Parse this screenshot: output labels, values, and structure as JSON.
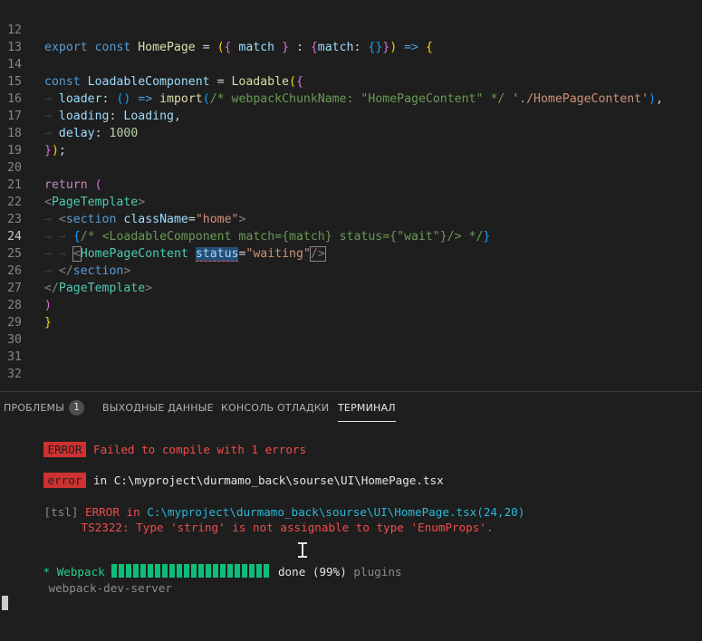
{
  "editor": {
    "lines": [
      {
        "n": "12",
        "t": [
          "export",
          " const ",
          "HomePage",
          " = ",
          "(",
          "{",
          " match ",
          "}",
          " : ",
          "{",
          "match",
          ": ",
          "{",
          "}",
          "}",
          ")",
          " => ",
          "{"
        ]
      },
      {
        "n": "13",
        "t": []
      },
      {
        "n": "14",
        "t": [
          "const ",
          "LoadableComponent",
          " = ",
          "Loadable",
          "(",
          "{"
        ]
      },
      {
        "n": "15",
        "t": [
          "loader",
          ": ",
          "(",
          ")",
          " => ",
          "import",
          "(",
          "/* webpackChunkName: \"HomePageContent\" */",
          " ",
          "'./HomePageContent'",
          ")",
          ","
        ]
      },
      {
        "n": "16",
        "t": [
          "loading",
          ": ",
          "Loading",
          ","
        ]
      },
      {
        "n": "17",
        "t": [
          "delay",
          ": ",
          "1000"
        ]
      },
      {
        "n": "18",
        "t": [
          "}",
          ")",
          ";"
        ]
      },
      {
        "n": "19",
        "t": []
      },
      {
        "n": "20",
        "t": [
          "return",
          " ",
          "("
        ]
      },
      {
        "n": "21",
        "t": [
          "<",
          "PageTemplate",
          ">"
        ]
      },
      {
        "n": "22",
        "t": [
          "<",
          "section",
          " ",
          "className",
          "=",
          "\"home\"",
          ">"
        ]
      },
      {
        "n": "23",
        "t": [
          "{",
          "/* <LoadableComponent match={match} status={\"wait\"}/> */",
          "}"
        ]
      },
      {
        "n": "24",
        "t": [
          "<",
          "HomePageContent",
          " ",
          "status",
          "=",
          "\"waiting\"",
          "/>"
        ]
      },
      {
        "n": "25",
        "t": [
          "</",
          "section",
          ">"
        ]
      },
      {
        "n": "26",
        "t": [
          "</",
          "PageTemplate",
          ">"
        ]
      },
      {
        "n": "27",
        "t": [
          ")"
        ]
      },
      {
        "n": "28",
        "t": [
          "}"
        ]
      },
      {
        "n": "29",
        "t": []
      },
      {
        "n": "30",
        "t": []
      },
      {
        "n": "31",
        "t": []
      },
      {
        "n": "32",
        "t": []
      }
    ],
    "active_line": "24",
    "guide_arrow": "→"
  },
  "panel": {
    "tabs": {
      "problems": "ПРОБЛЕМЫ",
      "problems_count": "1",
      "output": "ВЫХОДНЫЕ ДАННЫЕ",
      "debug_console": "КОНСОЛЬ ОТЛАДКИ",
      "terminal": "ТЕРМИНАЛ"
    },
    "terminal": {
      "line1_badge": "ERROR",
      "line1_text": "Failed to compile with 1 errors",
      "line2_badge": "error",
      "line2_in": "in",
      "line2_path": "C:\\myproject\\durmamo_back\\sourse\\UI\\HomePage.tsx",
      "line3_prefix": "[tsl]",
      "line3_error": "ERROR",
      "line3_in": "in",
      "line3_path": "C:\\myproject\\durmamo_back\\sourse\\UI\\HomePage.tsx(24,20)",
      "line4_text": "TS2322: Type 'string' is not assignable to type 'EnumProps'.",
      "line5_star": "*",
      "line5_name": "Webpack",
      "line5_done": "done",
      "line5_pct": "(99%)",
      "line5_plugins": "plugins",
      "line6_text": "webpack-dev-server",
      "progress": 0.99
    }
  },
  "colors": {
    "background": "#1e1e1e",
    "error_badge": "#cd3131",
    "error_text": "#f14c4c",
    "path_cyan": "#29b8db",
    "progress_green": "#0dbc79"
  }
}
